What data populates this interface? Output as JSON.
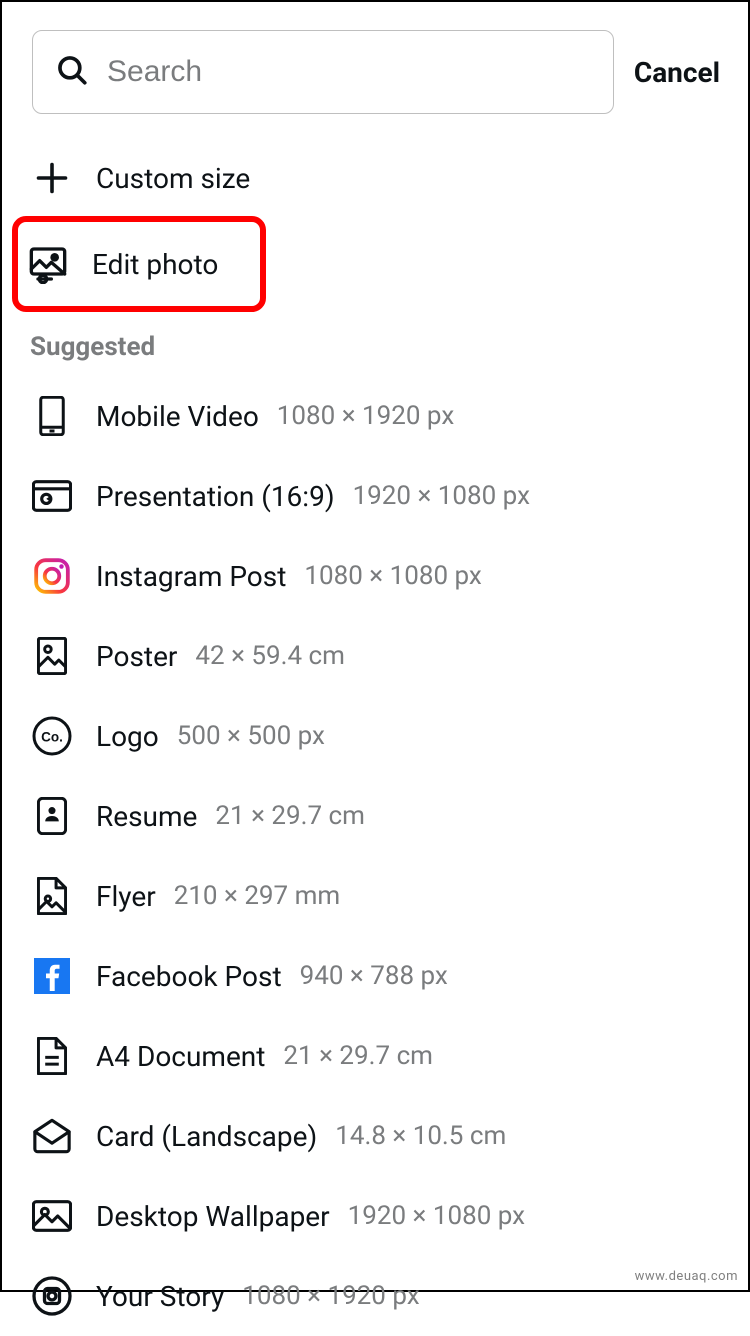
{
  "search": {
    "placeholder": "Search"
  },
  "cancel_label": "Cancel",
  "top_actions": [
    {
      "icon": "plus",
      "label": "Custom size"
    },
    {
      "icon": "photo-edit",
      "label": "Edit photo",
      "highlighted": true
    }
  ],
  "suggested_heading": "Suggested",
  "suggested": [
    {
      "icon": "mobile",
      "label": "Mobile Video",
      "dims": "1080 × 1920 px"
    },
    {
      "icon": "presentation",
      "label": "Presentation (16:9)",
      "dims": "1920 × 1080 px"
    },
    {
      "icon": "instagram",
      "label": "Instagram Post",
      "dims": "1080 × 1080 px"
    },
    {
      "icon": "poster",
      "label": "Poster",
      "dims": "42 × 59.4 cm"
    },
    {
      "icon": "logo",
      "label": "Logo",
      "dims": "500 × 500 px"
    },
    {
      "icon": "resume",
      "label": "Resume",
      "dims": "21 × 29.7 cm"
    },
    {
      "icon": "flyer",
      "label": "Flyer",
      "dims": "210 × 297 mm"
    },
    {
      "icon": "facebook",
      "label": "Facebook Post",
      "dims": "940 × 788 px"
    },
    {
      "icon": "a4",
      "label": "A4 Document",
      "dims": "21 × 29.7 cm"
    },
    {
      "icon": "card",
      "label": "Card (Landscape)",
      "dims": "14.8 × 10.5 cm"
    },
    {
      "icon": "wallpaper",
      "label": "Desktop Wallpaper",
      "dims": "1920 × 1080 px"
    },
    {
      "icon": "story",
      "label": "Your Story",
      "dims": "1080 × 1920 px"
    }
  ],
  "watermark": "www.deuaq.com"
}
